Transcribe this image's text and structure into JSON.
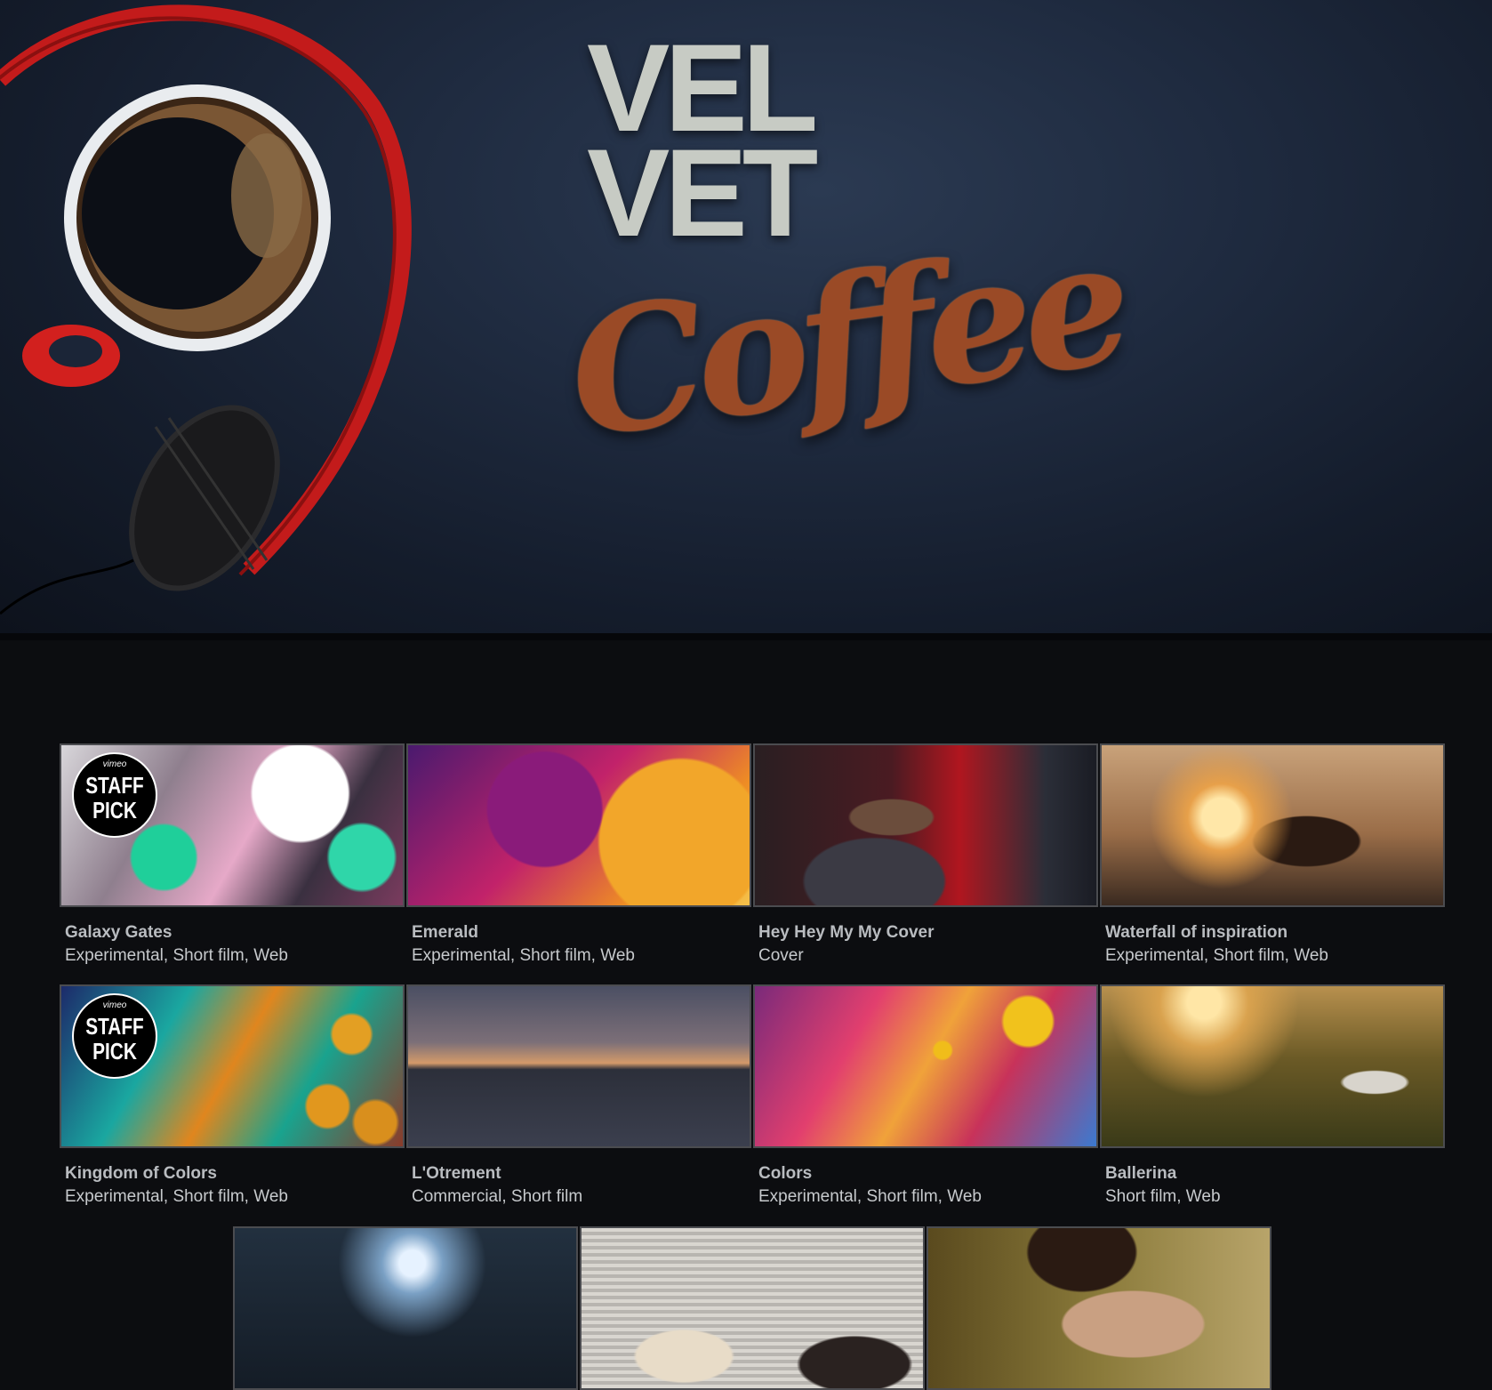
{
  "hero": {
    "logo_line1": "VEL",
    "logo_line2": "VET",
    "logo_script": "Coffee"
  },
  "badge": {
    "brand": "vimeo",
    "line1": "STAFF",
    "line2": "PICK"
  },
  "videos": [
    {
      "title": "Galaxy Gates",
      "tags": "Experimental, Short film, Web",
      "staff_pick": true
    },
    {
      "title": "Emerald",
      "tags": "Experimental, Short film, Web",
      "staff_pick": false
    },
    {
      "title": "Hey Hey My My Cover",
      "tags": "Cover",
      "staff_pick": false
    },
    {
      "title": "Waterfall of inspiration",
      "tags": "Experimental, Short film, Web",
      "staff_pick": false
    },
    {
      "title": "Kingdom of Colors",
      "tags": "Experimental, Short film, Web",
      "staff_pick": true
    },
    {
      "title": "L'Otrement",
      "tags": "Commercial, Short film",
      "staff_pick": false
    },
    {
      "title": "Colors",
      "tags": "Experimental, Short film, Web",
      "staff_pick": false
    },
    {
      "title": "Ballerina",
      "tags": "Short film, Web",
      "staff_pick": false
    },
    {
      "title": "",
      "tags": "",
      "staff_pick": false
    },
    {
      "title": "",
      "tags": "",
      "staff_pick": false
    },
    {
      "title": "",
      "tags": "",
      "staff_pick": false
    }
  ],
  "colors": {
    "background": "#0c0d10",
    "thumb_border": "#4b4c50",
    "title_text": "#b9bcc0",
    "tags_text": "#c7cacd",
    "logo_metal": "#c7cbc4",
    "logo_copper": "#9a4a26"
  },
  "icons": [
    "coffee-cup-icon",
    "headphones-icon",
    "staff-pick-badge-icon"
  ]
}
